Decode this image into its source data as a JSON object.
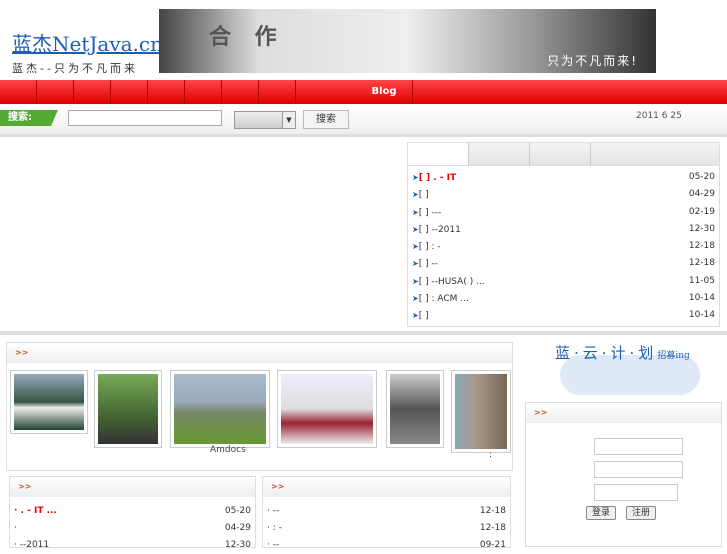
{
  "header": {
    "logo_title": "蓝杰NetJava.cn",
    "logo_slogan": "蓝杰--只为不凡而来",
    "banner_heading": "合 作",
    "banner_quote": "只为不凡而来!"
  },
  "nav": {
    "items": [
      "",
      "",
      "",
      "",
      "",
      "",
      "",
      "",
      "Blog"
    ]
  },
  "search": {
    "label": "搜索:",
    "input_value": "",
    "select_value": "",
    "button": "搜索",
    "date": "2011 6 25"
  },
  "news": {
    "tabs": [
      "",
      "",
      "",
      ""
    ],
    "items": [
      {
        "title": "[ ]    .    -      IT",
        "date": "05-20",
        "highlight": true
      },
      {
        "title": "[ ]",
        "date": "04-29"
      },
      {
        "title": "[ ]      ---",
        "date": "02-19"
      },
      {
        "title": "[ ]   --2011",
        "date": "12-30"
      },
      {
        "title": "[ ] :    -",
        "date": "12-18"
      },
      {
        "title": "[ ]   --",
        "date": "12-18"
      },
      {
        "title": "[ ]   --HUSA(    ) ...",
        "date": "11-05"
      },
      {
        "title": "[ ]       : ACM      ...",
        "date": "10-14"
      },
      {
        "title": "[ ]",
        "date": "10-14"
      }
    ]
  },
  "photos": {
    "header": ">>",
    "captions": [
      "Amdocs",
      ":"
    ]
  },
  "sidebar": {
    "recruit_title": "蓝·云·计·划",
    "recruit_sub": "招募ing",
    "login_header": ">>",
    "login_button": "登录",
    "register_button": "注册"
  },
  "bottom_left": {
    "header": ">>",
    "items": [
      {
        "title": "·    .   -     IT    ...",
        "date": "05-20",
        "highlight": true
      },
      {
        "title": "·",
        "date": "04-29"
      },
      {
        "title": "·  --2011",
        "date": "12-30"
      }
    ]
  },
  "bottom_right": {
    "header": ">>",
    "items": [
      {
        "title": "·   --",
        "date": "12-18"
      },
      {
        "title": "· :    -",
        "date": "12-18"
      },
      {
        "title": "·  --",
        "date": "09-21"
      }
    ]
  }
}
